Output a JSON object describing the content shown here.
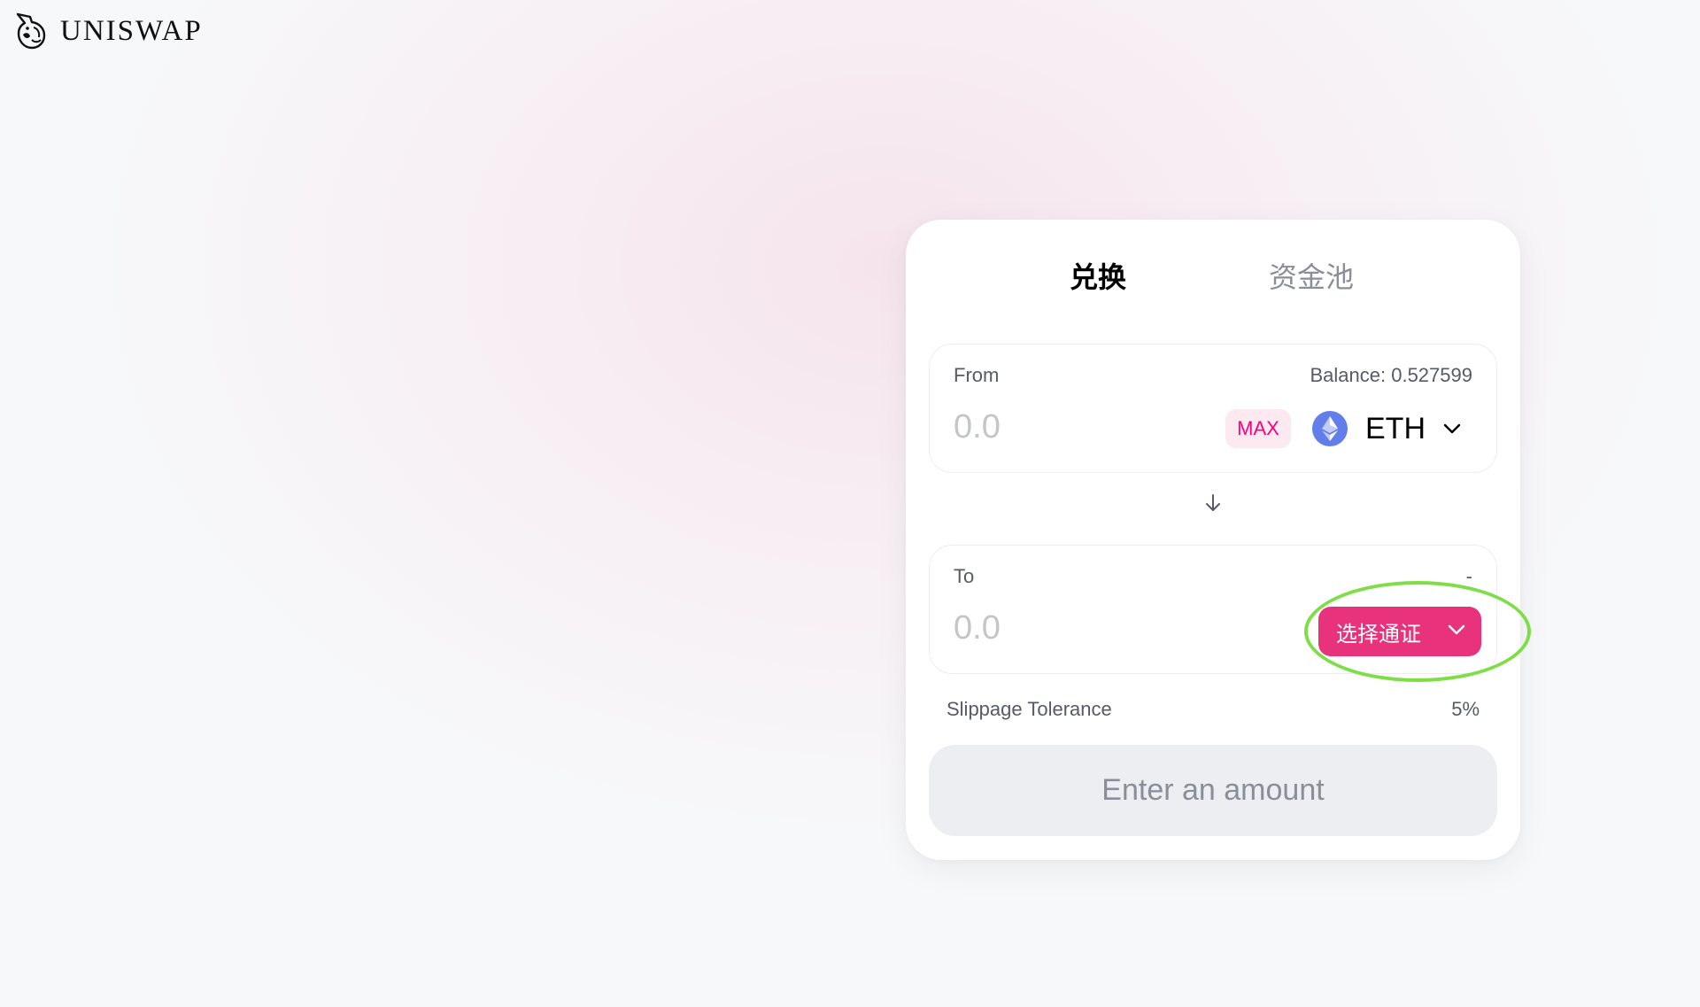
{
  "brand": {
    "logo_icon": "unicorn-icon",
    "name": "UNISWAP"
  },
  "tabs": [
    {
      "label": "兑换",
      "active": true
    },
    {
      "label": "资金池",
      "active": false
    }
  ],
  "from_panel": {
    "label": "From",
    "balance_text": "Balance: 0.527599",
    "amount_placeholder": "0.0",
    "max_label": "MAX",
    "token": {
      "icon": "ethereum-icon",
      "symbol": "ETH"
    }
  },
  "swap_direction_icon": "arrow-down-icon",
  "to_panel": {
    "label": "To",
    "right_text": "-",
    "amount_placeholder": "0.0",
    "select_token_label": "选择通证"
  },
  "slippage": {
    "label": "Slippage Tolerance",
    "value": "5%"
  },
  "submit": {
    "label": "Enter an amount"
  },
  "colors": {
    "accent_pink": "#ff007a",
    "select_button": "#e8327c",
    "eth_blue": "#627eea",
    "highlight_ring": "#7fde47"
  }
}
